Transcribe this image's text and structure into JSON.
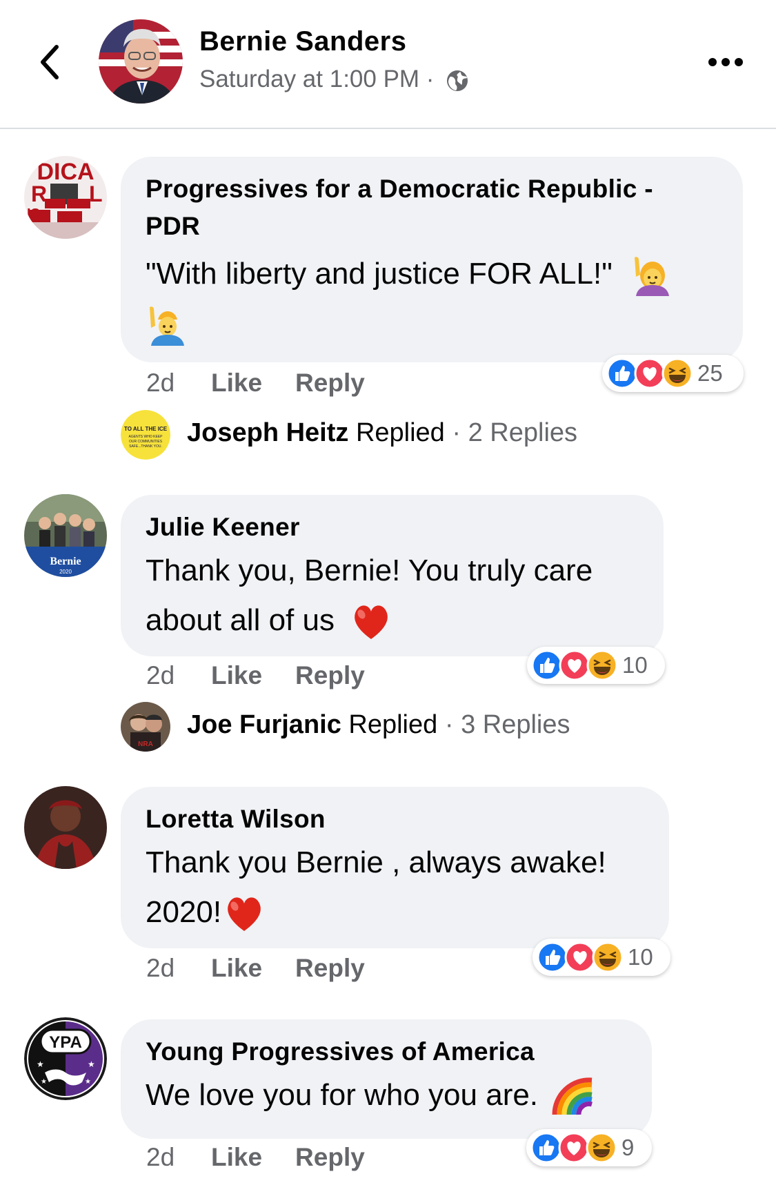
{
  "header": {
    "name": "Bernie Sanders",
    "timestamp": "Saturday at 1:00 PM ·",
    "privacy_icon": "globe-icon",
    "menu_icon": "more-dots-icon",
    "back_icon": "chevron-left-icon"
  },
  "comments": [
    {
      "author_line1": "Progressives for a Democratic Republic -",
      "author_line2": "PDR",
      "text": "\"With liberty and justice FOR ALL!\"",
      "emojis": [
        "woman-raising-hand-emoji",
        "man-raising-hand-emoji"
      ],
      "time": "2d",
      "like": "Like",
      "reply": "Reply",
      "reactions": [
        "like",
        "love",
        "haha"
      ],
      "reaction_count": "25",
      "replies": {
        "name": "Joseph Heitz",
        "action": "Replied",
        "sep": "·",
        "count": "2 Replies"
      }
    },
    {
      "author": "Julie Keener",
      "text_line1": "Thank you, Bernie! You truly care",
      "text_line2": "about all of us",
      "emojis": [
        "red-heart-emoji"
      ],
      "time": "2d",
      "like": "Like",
      "reply": "Reply",
      "reactions": [
        "like",
        "love",
        "haha"
      ],
      "reaction_count": "10",
      "replies": {
        "name": "Joe Furjanic",
        "action": "Replied",
        "sep": "·",
        "count": "3 Replies"
      }
    },
    {
      "author": "Loretta Wilson",
      "text_line1": "Thank you Bernie , always awake!",
      "text_line2": "2020!",
      "emojis": [
        "red-heart-emoji"
      ],
      "time": "2d",
      "like": "Like",
      "reply": "Reply",
      "reactions": [
        "like",
        "love",
        "haha"
      ],
      "reaction_count": "10"
    },
    {
      "author": "Young Progressives of America",
      "avatar_text": "YPA",
      "text": "We love you for who you are.",
      "emojis": [
        "rainbow-emoji"
      ],
      "time": "2d",
      "like": "Like",
      "reply": "Reply",
      "reactions": [
        "like",
        "love",
        "haha"
      ],
      "reaction_count": "9"
    }
  ],
  "colors": {
    "like_blue": "#1877f2",
    "love_red": "#f33e58",
    "haha_yellow": "#f7b125",
    "bubble_gray": "#f0f2f5",
    "meta_gray": "#65676b"
  }
}
